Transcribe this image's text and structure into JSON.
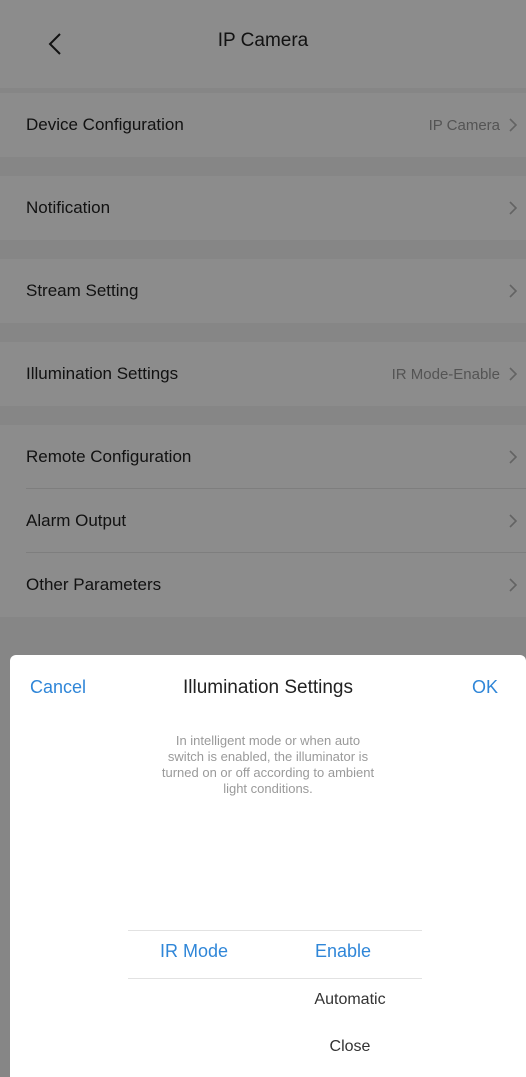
{
  "header": {
    "title": "IP Camera",
    "back_icon": "chevron-left-icon"
  },
  "settings": {
    "items": [
      {
        "label": "Device Configuration",
        "value": "IP Camera"
      },
      {
        "label": "Notification",
        "value": ""
      },
      {
        "label": "Stream Setting",
        "value": ""
      },
      {
        "label": "Illumination Settings",
        "value": "IR Mode-Enable"
      },
      {
        "label": "Remote Configuration",
        "value": ""
      },
      {
        "label": "Alarm Output",
        "value": ""
      },
      {
        "label": "Other Parameters",
        "value": ""
      }
    ]
  },
  "sheet": {
    "cancel_label": "Cancel",
    "title": "Illumination Settings",
    "ok_label": "OK",
    "hint": "In intelligent mode or when auto switch is enabled, the illuminator is turned on or off according to ambient light conditions.",
    "picker": {
      "left_selected": "IR Mode",
      "right_selected": "Enable",
      "right_options": [
        "Automatic",
        "Close"
      ]
    }
  },
  "colors": {
    "accent": "#2f86d8",
    "overlay": "rgba(0,0,0,0.45)"
  }
}
